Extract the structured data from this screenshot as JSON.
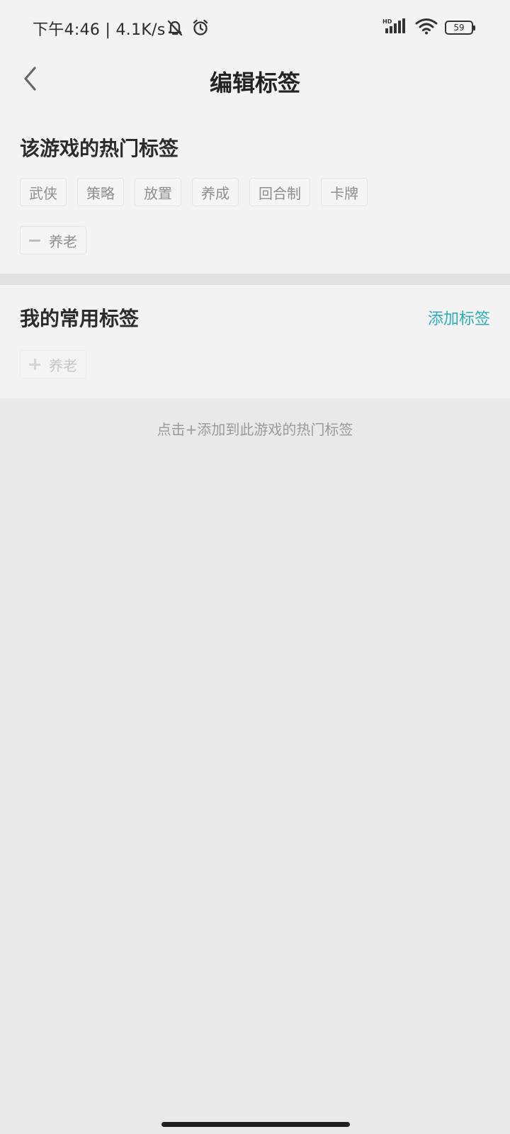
{
  "status_bar": {
    "time": "下午4:46 | 4.1K/s",
    "battery_percent": 59,
    "battery_level": 0.59,
    "icons": [
      "mute-bell-icon",
      "alarm-icon",
      "hd-signal-icon",
      "wifi-icon",
      "battery-icon"
    ]
  },
  "header": {
    "title": "编辑标签",
    "back_icon": "chevron-left-icon"
  },
  "hot_tags": {
    "title": "该游戏的热门标签",
    "row1": [
      "武侠",
      "策略",
      "放置",
      "养成",
      "回合制",
      "卡牌"
    ],
    "row2": [
      "养老"
    ]
  },
  "my_tags": {
    "title": "我的常用标签",
    "add_label": "添加标签",
    "items": [
      "养老"
    ]
  },
  "hint": "点击+添加到此游戏的热门标签",
  "colors": {
    "accent": "#2ab0b8",
    "background": "#e9e9e9",
    "panel": "#f3f3f3"
  }
}
